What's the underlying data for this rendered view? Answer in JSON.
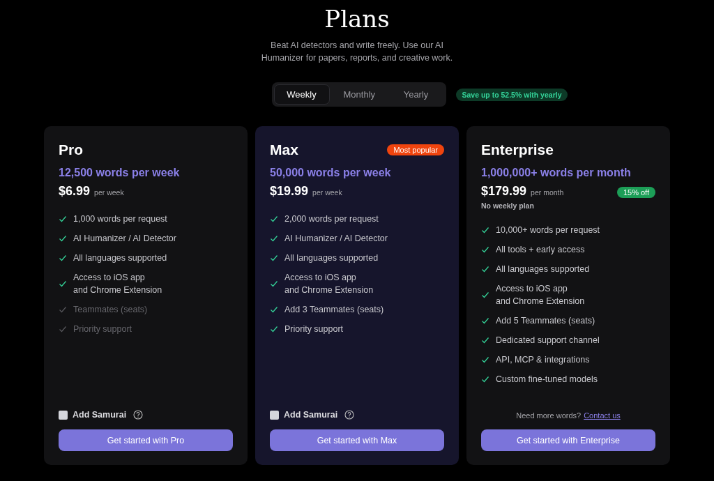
{
  "header": {
    "title": "Plans",
    "subtitle": "Beat AI detectors and write freely. Use our AI Humanizer for papers, reports, and creative work."
  },
  "billing_tabs": [
    {
      "label": "Weekly",
      "selected": true
    },
    {
      "label": "Monthly",
      "selected": false
    },
    {
      "label": "Yearly",
      "selected": false
    }
  ],
  "savings_badge": "Save up to 52.5% with yearly",
  "plans": [
    {
      "name": "Pro",
      "highlighted": false,
      "quota": "12,500 words per week",
      "price": "$6.99",
      "period": "per week",
      "features": [
        {
          "text": "1,000 words per request",
          "included": true
        },
        {
          "text": "AI Humanizer / AI Detector",
          "included": true
        },
        {
          "text": "All languages supported",
          "included": true
        },
        {
          "text": "Access to iOS app\nand Chrome Extension",
          "included": true
        },
        {
          "text": "Teammates (seats)",
          "included": false
        },
        {
          "text": "Priority support",
          "included": false
        }
      ],
      "addon": {
        "label": "Add Samurai",
        "checked": false
      },
      "button": "Get started with Pro"
    },
    {
      "name": "Max",
      "highlighted": true,
      "badge": {
        "kind": "popular",
        "text": "Most popular"
      },
      "quota": "50,000 words per week",
      "price": "$19.99",
      "period": "per week",
      "features": [
        {
          "text": "2,000 words per request",
          "included": true
        },
        {
          "text": "AI Humanizer / AI Detector",
          "included": true
        },
        {
          "text": "All languages supported",
          "included": true
        },
        {
          "text": "Access to iOS app\nand Chrome Extension",
          "included": true
        },
        {
          "text": "Add 3 Teammates (seats)",
          "included": true
        },
        {
          "text": "Priority support",
          "included": true
        }
      ],
      "addon": {
        "label": "Add Samurai",
        "checked": false
      },
      "button": "Get started with Max"
    },
    {
      "name": "Enterprise",
      "highlighted": false,
      "quota": "1,000,000+ words per month",
      "price": "$179.99",
      "period": "per month",
      "price_badge": {
        "kind": "discount",
        "text": "15% off"
      },
      "price_note": "No weekly plan",
      "features": [
        {
          "text": "10,000+ words per request",
          "included": true
        },
        {
          "text": "All tools + early access",
          "included": true
        },
        {
          "text": "All languages supported",
          "included": true
        },
        {
          "text": "Access to iOS app\nand Chrome Extension",
          "included": true
        },
        {
          "text": "Add 5 Teammates (seats)",
          "included": true
        },
        {
          "text": "Dedicated support channel",
          "included": true
        },
        {
          "text": "API, MCP & integrations",
          "included": true
        },
        {
          "text": "Custom fine-tuned models",
          "included": true
        }
      ],
      "contact": {
        "text": "Need more words?",
        "link": "Contact us"
      },
      "button": "Get started with Enterprise"
    }
  ]
}
